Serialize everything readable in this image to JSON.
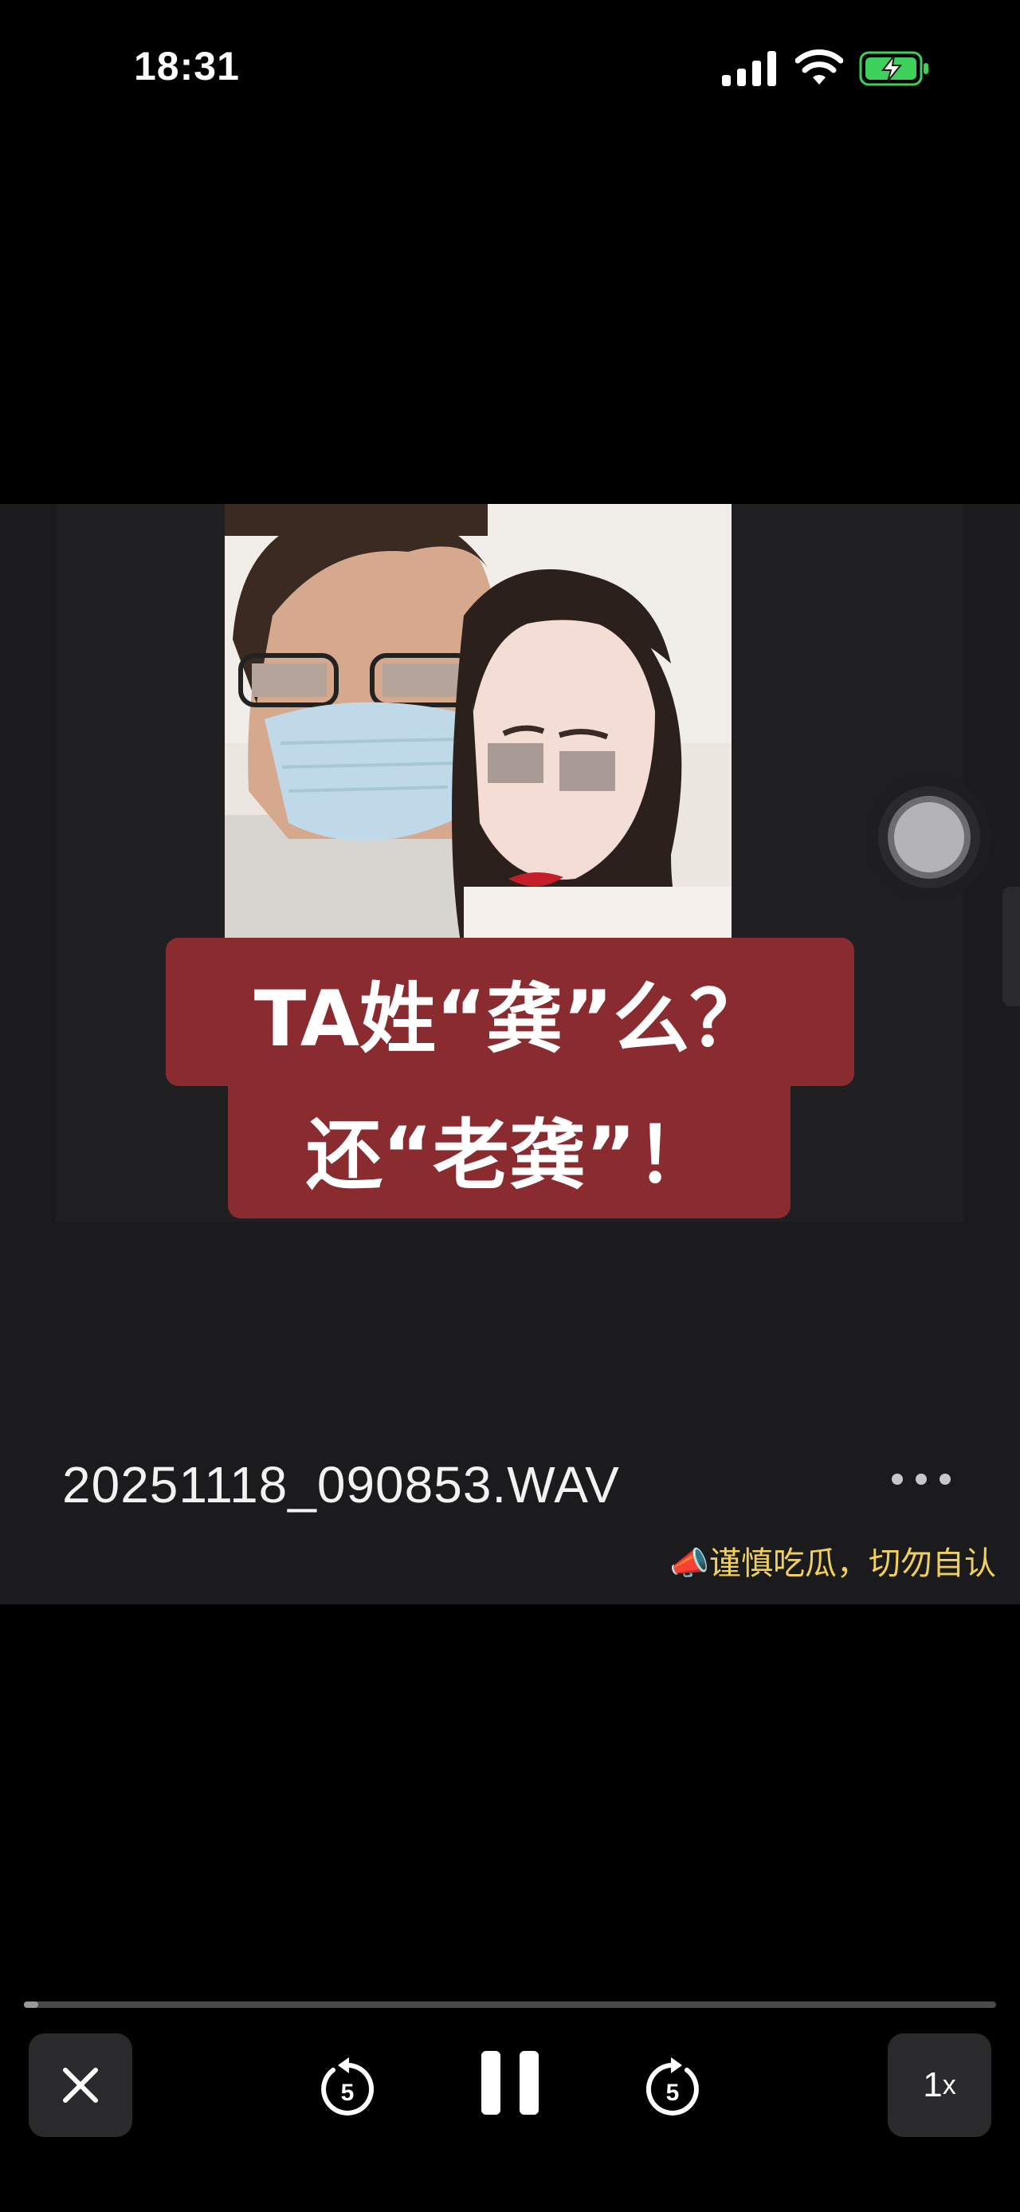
{
  "status_bar": {
    "time": "18:31",
    "signal_icon": "cellular-signal-icon",
    "wifi_icon": "wifi-icon",
    "battery_icon": "battery-charging-icon",
    "battery_color": "#3dd05a"
  },
  "video": {
    "caption_line1": "TA姓“龚”么？",
    "caption_line2": "还“老龚”！",
    "caption_bg": "#8a2b30",
    "filename": "20251118_090853.WAV",
    "watermark": "📣谨慎吃瓜，切勿自认",
    "watermark_color": "#f0cf5a"
  },
  "player": {
    "progress": 0.015,
    "rewind_seconds": "5",
    "forward_seconds": "5",
    "speed_label": "1",
    "speed_suffix": "x",
    "close_icon": "close-icon",
    "pause_icon": "pause-icon"
  }
}
